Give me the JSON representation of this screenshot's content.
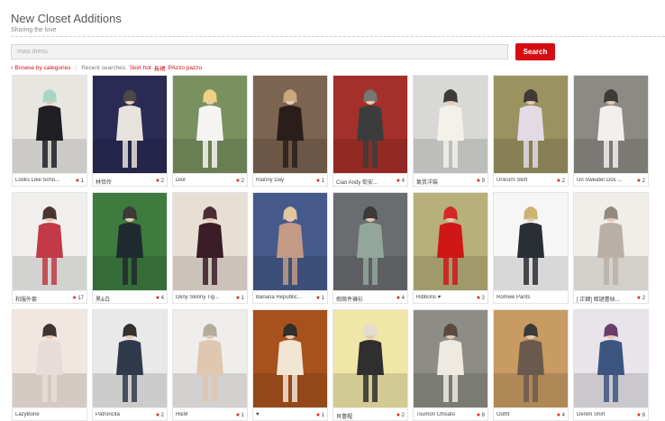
{
  "header": {
    "title": "New Closet Additions",
    "subtitle": "Sharing the love"
  },
  "search": {
    "placeholder": "maxi dress",
    "button_label": "Search"
  },
  "nav": {
    "browse_label": "Browse by categories",
    "recent_label": "Recent searches:",
    "recent": [
      "Skirt hot",
      "長裙",
      "PAzzo pazzo"
    ]
  },
  "colors": {
    "accent": "#d40d12",
    "link": "#cc1111"
  },
  "items": [
    {
      "title": "Looks Like Scho...",
      "count": "1",
      "bg": "#e9e6e2",
      "fig": "#1f1f24",
      "top": "#9fd8c8"
    },
    {
      "title": "林恬伶",
      "count": "2",
      "bg": "#2b2a55",
      "fig": "#e7e2dc",
      "top": "#3a3a3a"
    },
    {
      "title": "Dior",
      "count": "2",
      "bg": "#79905f",
      "fig": "#f5f4f2",
      "top": "#f0d27a"
    },
    {
      "title": "Rainny Day",
      "count": "1",
      "bg": "#7b6450",
      "fig": "#2a1e1a",
      "top": "#c9a47b"
    },
    {
      "title": "Ciao Andy 街安...",
      "count": "4",
      "bg": "#a5302b",
      "fig": "#3a3d3b",
      "top": "#6a6f6a"
    },
    {
      "title": "氣質洋裝",
      "count": "9",
      "bg": "#d8d8d6",
      "fig": "#f4f1ea",
      "top": "#2a2a2a"
    },
    {
      "title": "Unicorn Skirt",
      "count": "2",
      "bg": "#9a9260",
      "fig": "#e2dbe4",
      "top": "#2a2a2a"
    },
    {
      "title": "Un Sweater Dos ...",
      "count": "2",
      "bg": "#8c8a84",
      "fig": "#f2f0ee",
      "top": "#2a2a2a"
    },
    {
      "title": "和服外套",
      "count": "17",
      "bg": "#f0efee",
      "fig": "#c23a47",
      "top": "#3a2420"
    },
    {
      "title": "黑&白",
      "count": "4",
      "bg": "#3e7b3f",
      "fig": "#1f2a2f",
      "top": "#2a2a2a"
    },
    {
      "title": "Dkny Skinny Tig...",
      "count": "1",
      "bg": "#e7dfd4",
      "fig": "#3a1d27",
      "top": "#3a1d27"
    },
    {
      "title": "Banana Republic...",
      "count": "1",
      "bg": "#455a8a",
      "fig": "#c29a86",
      "top": "#e2c79b"
    },
    {
      "title": "假兩件褲衫",
      "count": "4",
      "bg": "#6a6d70",
      "fig": "#93a69b",
      "top": "#2a2a2a"
    },
    {
      "title": "Ribbons ♥",
      "count": "2",
      "bg": "#b7b07a",
      "fig": "#d01717",
      "top": "#d01717"
    },
    {
      "title": "Romwe Pants",
      "count": "",
      "bg": "#f6f6f6",
      "fig": "#2a2f35",
      "top": "#c9b06a"
    },
    {
      "title": "[ 正韓] 暗謎蕾絲...",
      "count": "2",
      "bg": "#f1ede8",
      "fig": "#b8b0a7",
      "top": "#8b8278"
    },
    {
      "title": "LazyBone",
      "count": "",
      "bg": "#f2e6e0",
      "fig": "#e7dcd7",
      "top": "#2a2523"
    },
    {
      "title": "Patroncita",
      "count": "2",
      "bg": "#e9e9e9",
      "fig": "#2f3a4a",
      "top": "#1f1f1f"
    },
    {
      "title": "H&M",
      "count": "1",
      "bg": "#efeeec",
      "fig": "#dfc7b0",
      "top": "#ada79a"
    },
    {
      "title": "♥",
      "count": "1",
      "bg": "#a7521d",
      "fig": "#f1e5d4",
      "top": "#1e1e1e"
    },
    {
      "title": "貝蕾帽",
      "count": "2",
      "bg": "#f0e6a8",
      "fig": "#2f2f2f",
      "top": "#e4ddd1"
    },
    {
      "title": "Tsumori Chisato",
      "count": "8",
      "bg": "#8d8c86",
      "fig": "#eeeae1",
      "top": "#4a3c33"
    },
    {
      "title": "Outfit",
      "count": "4",
      "bg": "#c89b63",
      "fig": "#6a5a4e",
      "top": "#2a2a2a"
    },
    {
      "title": "Denim Shirt",
      "count": "8",
      "bg": "#e8e4ea",
      "fig": "#3b5580",
      "top": "#5e2d63"
    }
  ]
}
